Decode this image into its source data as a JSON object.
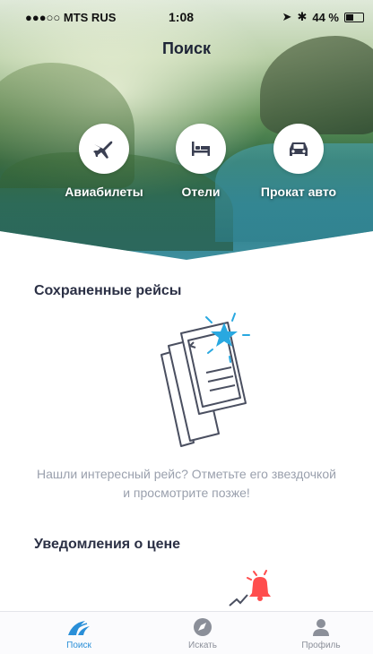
{
  "status_bar": {
    "carrier": "●●●○○ MTS RUS",
    "time": "1:08",
    "battery": "44 %"
  },
  "header": {
    "title": "Поиск"
  },
  "categories": [
    {
      "label": "Авиабилеты",
      "icon": "plane-icon"
    },
    {
      "label": "Отели",
      "icon": "bed-icon"
    },
    {
      "label": "Прокат авто",
      "icon": "car-icon"
    }
  ],
  "saved_flights": {
    "title": "Сохраненные рейсы",
    "empty_text": "Нашли интересный рейс? Отметьте его звездочкой и просмотрите позже!"
  },
  "price_alerts": {
    "title": "Уведомления о цене"
  },
  "tabbar": {
    "items": [
      {
        "label": "Поиск",
        "icon": "search-wave-icon",
        "active": true
      },
      {
        "label": "Искать",
        "icon": "compass-icon",
        "active": false
      },
      {
        "label": "Профиль",
        "icon": "profile-icon",
        "active": false
      }
    ]
  },
  "colors": {
    "accent": "#2a8fd8",
    "star": "#29a8e0",
    "bell": "#ff4d4d",
    "hero_icon": "#3a3f52"
  }
}
